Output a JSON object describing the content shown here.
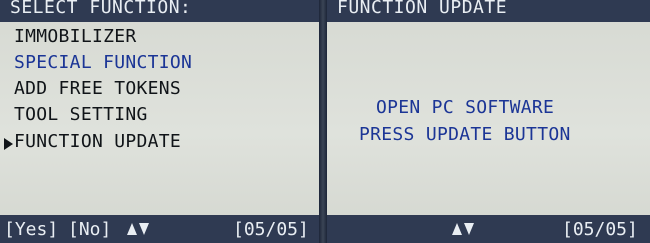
{
  "left_screen": {
    "header": "SELECT FUNCTION:",
    "menu_items": [
      {
        "label": "IMMOBILIZER"
      },
      {
        "label": "SPECIAL FUNCTION"
      },
      {
        "label": "ADD FREE TOKENS"
      },
      {
        "label": "TOOL SETTING"
      },
      {
        "label": "FUNCTION UPDATE",
        "selected": true
      }
    ],
    "footer": {
      "yes_label": "[Yes]",
      "no_label": "[No]",
      "page_indicator": "[05/05]"
    }
  },
  "right_screen": {
    "header": "FUNCTION UPDATE",
    "message_lines": [
      "OPEN PC SOFTWARE",
      "PRESS UPDATE BUTTON"
    ],
    "footer": {
      "page_indicator": "[05/05]"
    }
  },
  "colors": {
    "bar": "#2f3a52",
    "bar_text": "#e9eef3",
    "menu_black": "#101418",
    "menu_blue": "#1b3596",
    "screen_bg": "#dfe2dc"
  },
  "icons": [
    "selection-arrow-icon",
    "scroll-up-icon",
    "scroll-down-icon"
  ]
}
